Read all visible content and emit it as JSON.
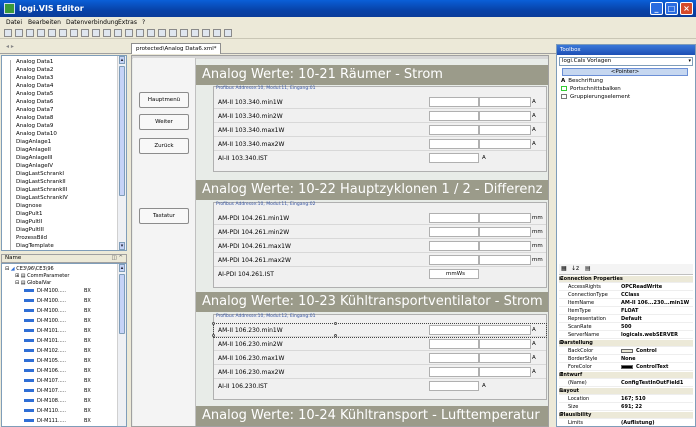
{
  "window": {
    "title": "logi.VIS Editor"
  },
  "menu": [
    "Datei",
    "Bearbeiten",
    "Datenverbindung",
    "Extras",
    "?"
  ],
  "tab": {
    "label": "protected\\Analog Data6.xml*"
  },
  "tree": {
    "items": [
      "Analog Data1",
      "Analog Data2",
      "Analog Data3",
      "Analog Data4",
      "Analog Data5",
      "Analog Data6",
      "Analog Data7",
      "Analog Data8",
      "Analog Data9",
      "Analog Data10",
      "DiagAnlage1",
      "DiagAnlageII",
      "DiagAnlageIII",
      "DiagAnlageIV",
      "DiagLastSchrankI",
      "DiagLastSchrankII",
      "DiagLastSchrankIII",
      "DiagLastSchrankIV",
      "Diagnose",
      "DiagPult1",
      "DiagPultII",
      "DiagPultIII",
      "ProzessBild",
      "DiagTemplate"
    ]
  },
  "vars": {
    "header": "Name",
    "root": "CE3\\96\\CE3\\96",
    "children": [
      "CommParameter",
      "GlobalVar"
    ],
    "items": [
      {
        "name": "DI-M100.....",
        "type": "BX"
      },
      {
        "name": "DI-M100.....",
        "type": "BX"
      },
      {
        "name": "DI-M100.....",
        "type": "BX"
      },
      {
        "name": "DI-M100.....",
        "type": "BX"
      },
      {
        "name": "DI-M101.....",
        "type": "BX"
      },
      {
        "name": "DI-M101.....",
        "type": "BX"
      },
      {
        "name": "DI-M102.....",
        "type": "BX"
      },
      {
        "name": "DI-M105.....",
        "type": "BX"
      },
      {
        "name": "DI-M106.....",
        "type": "BX"
      },
      {
        "name": "DI-M107.....",
        "type": "BX"
      },
      {
        "name": "DI-M107.....",
        "type": "BX"
      },
      {
        "name": "DI-M108.....",
        "type": "BX"
      },
      {
        "name": "DI-M110.....",
        "type": "BX"
      },
      {
        "name": "DI-M111.....",
        "type": "BX"
      }
    ]
  },
  "nav": {
    "hauptmenu": "Hauptmenü",
    "weiter": "Weiter",
    "zurueck": "Zurück",
    "tastatur": "Tastatur"
  },
  "sections": [
    {
      "title": "Analog Werte: 10-21 Räumer - Strom",
      "group": "Profibus Addresse:10, Modul:11, Eingang:01",
      "rows": [
        {
          "label": "AM-II 103.340.min1W",
          "unit": "A"
        },
        {
          "label": "AM-II 103.340.min2W",
          "unit": "A"
        },
        {
          "label": "AM-II 103.340.max1W",
          "unit": "A"
        },
        {
          "label": "AM-II 103.340.max2W",
          "unit": "A"
        }
      ],
      "ist": {
        "label": "AI-II 103.340.IST",
        "unit": "A"
      }
    },
    {
      "title": "Analog Werte: 10-22 Hauptzyklonen 1 / 2 - Differenz",
      "group": "Profibus Addresse:10, Modul:11, Eingang:02",
      "rows": [
        {
          "label": "AM-PDI 104.261.min1W",
          "unit": "mm"
        },
        {
          "label": "AM-PDI 104.261.min2W",
          "unit": "mm"
        },
        {
          "label": "AM-PDI 104.261.max1W",
          "unit": "mm"
        },
        {
          "label": "AM-PDI 104.261.max2W",
          "unit": "mm"
        }
      ],
      "ist": {
        "label": "AI-PDI 104.261.IST",
        "unit": "mmWs"
      }
    },
    {
      "title": "Analog Werte: 10-23 Kühltransportventilator - Strom",
      "group": "Profibus Addresse:10, Modul:12, Eingang:01",
      "rows": [
        {
          "label": "AM-II 106.230.min1W",
          "unit": "A"
        },
        {
          "label": "AM-II 106.230.min2W",
          "unit": "A"
        },
        {
          "label": "AM-II 106.230.max1W",
          "unit": "A"
        },
        {
          "label": "AM-II 106.230.max2W",
          "unit": "A"
        }
      ],
      "ist": {
        "label": "AI-II 106.230.IST",
        "unit": "A"
      }
    },
    {
      "title": "Analog Werte: 10-24 Kühltransport - Lufttemperatur"
    }
  ],
  "toolbox": {
    "title": "Toolbox",
    "dropdown": "logi.Cals Vorlagen",
    "pointer": "<Pointer>",
    "items": [
      "Beschriftung",
      "Portschnittsbalken",
      "Gruppierungselement"
    ]
  },
  "properties": {
    "rows": [
      {
        "cat": true,
        "name": "Connection Properties"
      },
      {
        "name": "AccessRights",
        "value": "OPCReadWrite"
      },
      {
        "name": "ConnectionType",
        "value": "CClass"
      },
      {
        "name": "ItemName",
        "value": "AM-II 106...230...min1W"
      },
      {
        "name": "ItemType",
        "value": "FLOAT"
      },
      {
        "name": "Representation",
        "value": "Default"
      },
      {
        "name": "ScanRate",
        "value": "500"
      },
      {
        "name": "ServerName",
        "value": "logicals.webSERVER"
      },
      {
        "cat": true,
        "name": "Darstellung"
      },
      {
        "name": "BackColor",
        "value": "Control",
        "swatch": "#ece9d8"
      },
      {
        "name": "BorderStyle",
        "value": "None"
      },
      {
        "name": "ForeColor",
        "value": "ControlText",
        "swatch": "#000000"
      },
      {
        "cat": true,
        "name": "Entwurf"
      },
      {
        "name": "(Name)",
        "value": "ConfigTestInOutField1"
      },
      {
        "cat": true,
        "name": "Layout"
      },
      {
        "name": "Location",
        "value": "167; 510"
      },
      {
        "name": "Size",
        "value": "691; 22"
      },
      {
        "cat": true,
        "name": "Plausibility"
      },
      {
        "name": "Limits",
        "value": "(Auflistung)"
      }
    ]
  }
}
